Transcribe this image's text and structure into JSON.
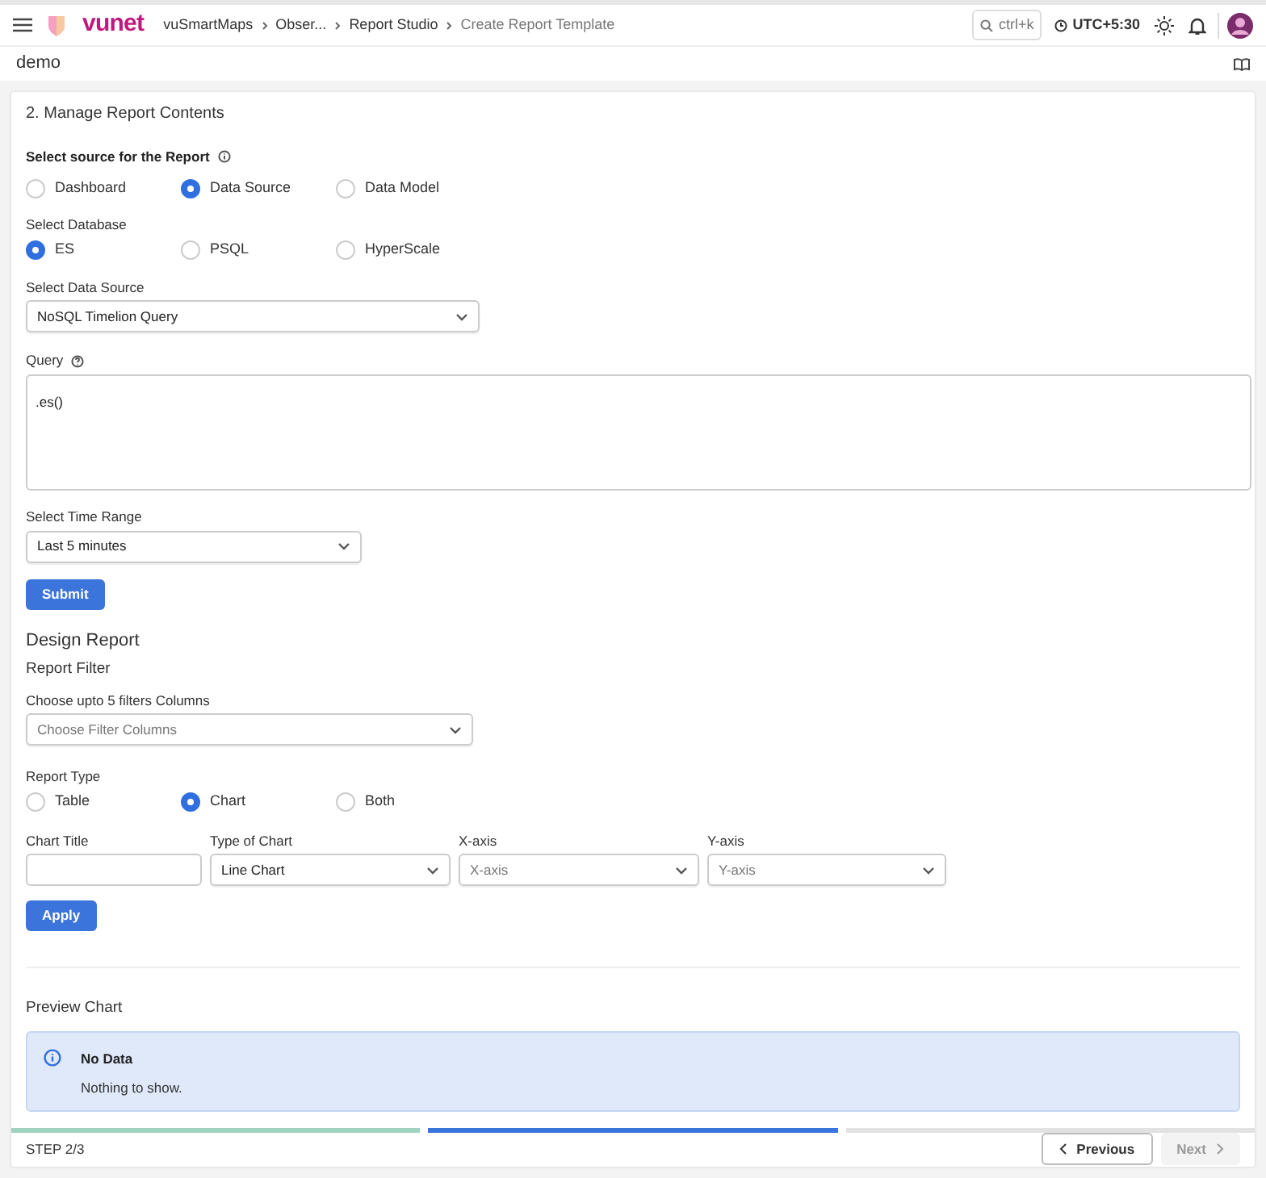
{
  "topbar": {
    "brand": "vunet",
    "breadcrumbs": [
      {
        "label": "vuSmartMaps",
        "current": false
      },
      {
        "label": "Obser...",
        "current": false
      },
      {
        "label": "Report Studio",
        "current": false
      },
      {
        "label": "Create Report Template",
        "current": true
      }
    ],
    "search": {
      "placeholder": "ctrl+k"
    },
    "timezone": "UTC+5:30"
  },
  "page_title": "demo",
  "section_title": "2. Manage Report Contents",
  "source": {
    "label": "Select source for the Report",
    "options": [
      {
        "label": "Dashboard",
        "selected": false
      },
      {
        "label": "Data Source",
        "selected": true
      },
      {
        "label": "Data Model",
        "selected": false
      }
    ]
  },
  "database": {
    "label": "Select Database",
    "options": [
      {
        "label": "ES",
        "selected": true
      },
      {
        "label": "PSQL",
        "selected": false
      },
      {
        "label": "HyperScale",
        "selected": false
      }
    ]
  },
  "data_source": {
    "label": "Select Data Source",
    "value": "NoSQL Timelion Query"
  },
  "query": {
    "label": "Query",
    "value": ".es()"
  },
  "time_range": {
    "label": "Select Time Range",
    "value": "Last 5 minutes"
  },
  "submit": "Submit",
  "design_title": "Design Report",
  "filter_title": "Report Filter",
  "filter": {
    "label": "Choose upto 5 filters Columns",
    "placeholder": "Choose Filter Columns"
  },
  "report_type": {
    "label": "Report Type",
    "options": [
      {
        "label": "Table",
        "selected": false
      },
      {
        "label": "Chart",
        "selected": true
      },
      {
        "label": "Both",
        "selected": false
      }
    ]
  },
  "chart_fields": [
    {
      "kind": "text",
      "label": "Chart Title"
    },
    {
      "kind": "select",
      "label": "Type of Chart",
      "value": "Line Chart"
    },
    {
      "kind": "select",
      "label": "X-axis",
      "placeholder": "X-axis"
    },
    {
      "kind": "select",
      "label": "Y-axis",
      "placeholder": "Y-axis"
    }
  ],
  "apply": "Apply",
  "preview": {
    "title": "Preview Chart",
    "alert_title": "No Data",
    "alert_text": "Nothing to show."
  },
  "steps": [
    {
      "completed": true,
      "selected": false
    },
    {
      "completed": false,
      "selected": true
    },
    {
      "completed": false,
      "selected": false
    }
  ],
  "footer": {
    "step": "STEP 2/3",
    "previous": {
      "label": "Previous",
      "disabled": false
    },
    "next": {
      "label": "Next",
      "disabled": true
    }
  }
}
